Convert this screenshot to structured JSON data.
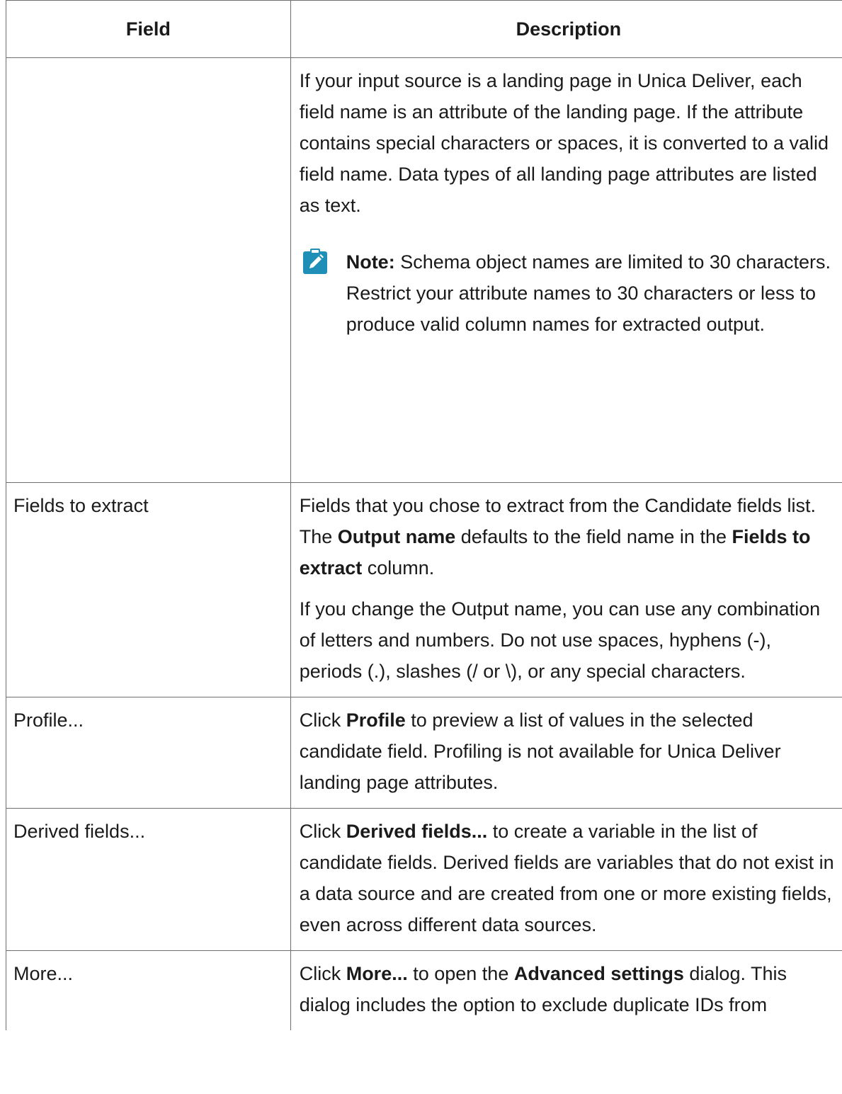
{
  "table": {
    "headers": {
      "field": "Field",
      "description": "Description"
    },
    "row0": {
      "field": "",
      "p1": "If your input source is a landing page in Unica Deliver, each field name is an attribute of the landing page. If the attribute contains special characters or spaces, it is converted to a valid field name. Data types of all landing page attributes are listed as text.",
      "note_label": "Note:",
      "note_text": " Schema object names are limited to 30 characters. Restrict your attribute names to 30 characters or less to produce valid column names for extracted output.",
      "note_icon": "pencil-edit-icon"
    },
    "row1": {
      "field": "Fields to extract",
      "p1_a": "Fields that you chose to extract from the Candidate fields list. The ",
      "p1_b": "Output name",
      "p1_c": " defaults to the field name in the ",
      "p1_d": "Fields to extract",
      "p1_e": " column.",
      "p2": "If you change the Output name, you can use any combination of letters and numbers. Do not use spaces, hyphens (-), periods (.), slashes (/ or \\), or any special characters."
    },
    "row2": {
      "field": "Profile...",
      "p1_a": "Click ",
      "p1_b": "Profile",
      "p1_c": " to preview a list of values in the selected candidate field. Profiling is not available for Unica Deliver landing page attributes."
    },
    "row3": {
      "field": "Derived fields...",
      "p1_a": "Click ",
      "p1_b": "Derived fields...",
      "p1_c": " to create a variable in the list of candidate fields. Derived fields are variables that do not exist in a data source and are created from one or more existing fields, even across different data sources."
    },
    "row4": {
      "field": "More...",
      "p1_a": "Click ",
      "p1_b": "More...",
      "p1_c": " to open the ",
      "p1_d": "Advanced settings",
      "p1_e": " dialog. This dialog includes the option to exclude duplicate IDs from"
    }
  },
  "colors": {
    "note_icon": "#1f8fb8",
    "border": "#6e6e6e"
  }
}
